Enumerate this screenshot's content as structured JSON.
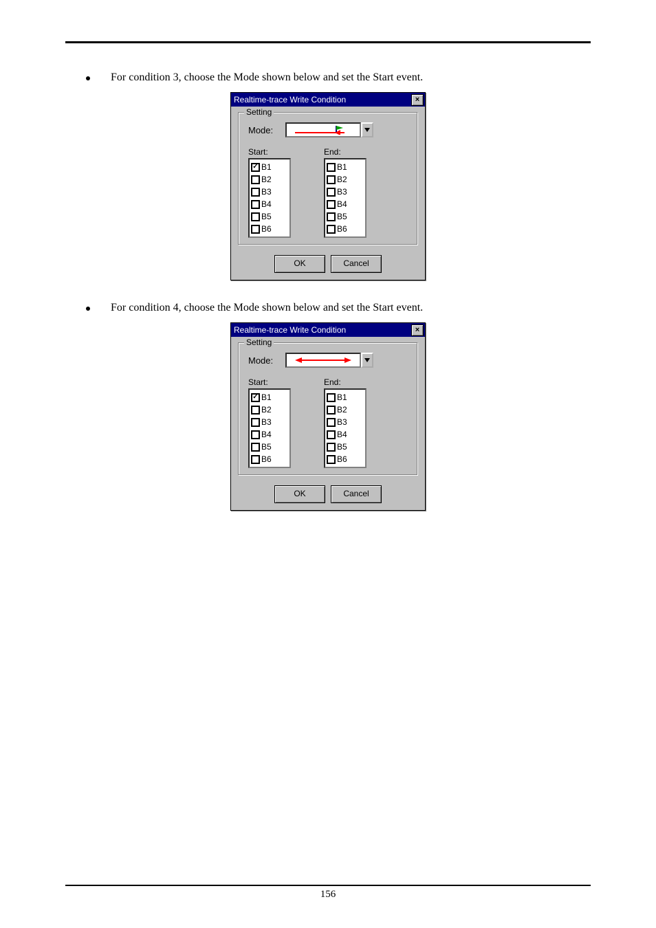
{
  "page_number": "156",
  "paragraphs": {
    "para1": "For condition 3, choose the Mode shown below and set the Start event.",
    "para2": "For condition 4, choose the Mode shown below and set the Start event."
  },
  "dialog": {
    "title": "Realtime-trace Write Condition",
    "close_glyph": "×",
    "group_legend": "Setting",
    "mode_label": "Mode:",
    "start_label": "Start:",
    "end_label": "End:",
    "items": [
      "B1",
      "B2",
      "B3",
      "B4",
      "B5",
      "B6"
    ],
    "ok_label": "OK",
    "cancel_label": "Cancel"
  },
  "dialog1": {
    "start_checked_index": 0,
    "end_checked_index": -1,
    "mode_icon": "mode-3"
  },
  "dialog2": {
    "start_checked_index": 0,
    "end_checked_index": -1,
    "mode_icon": "mode-4"
  }
}
